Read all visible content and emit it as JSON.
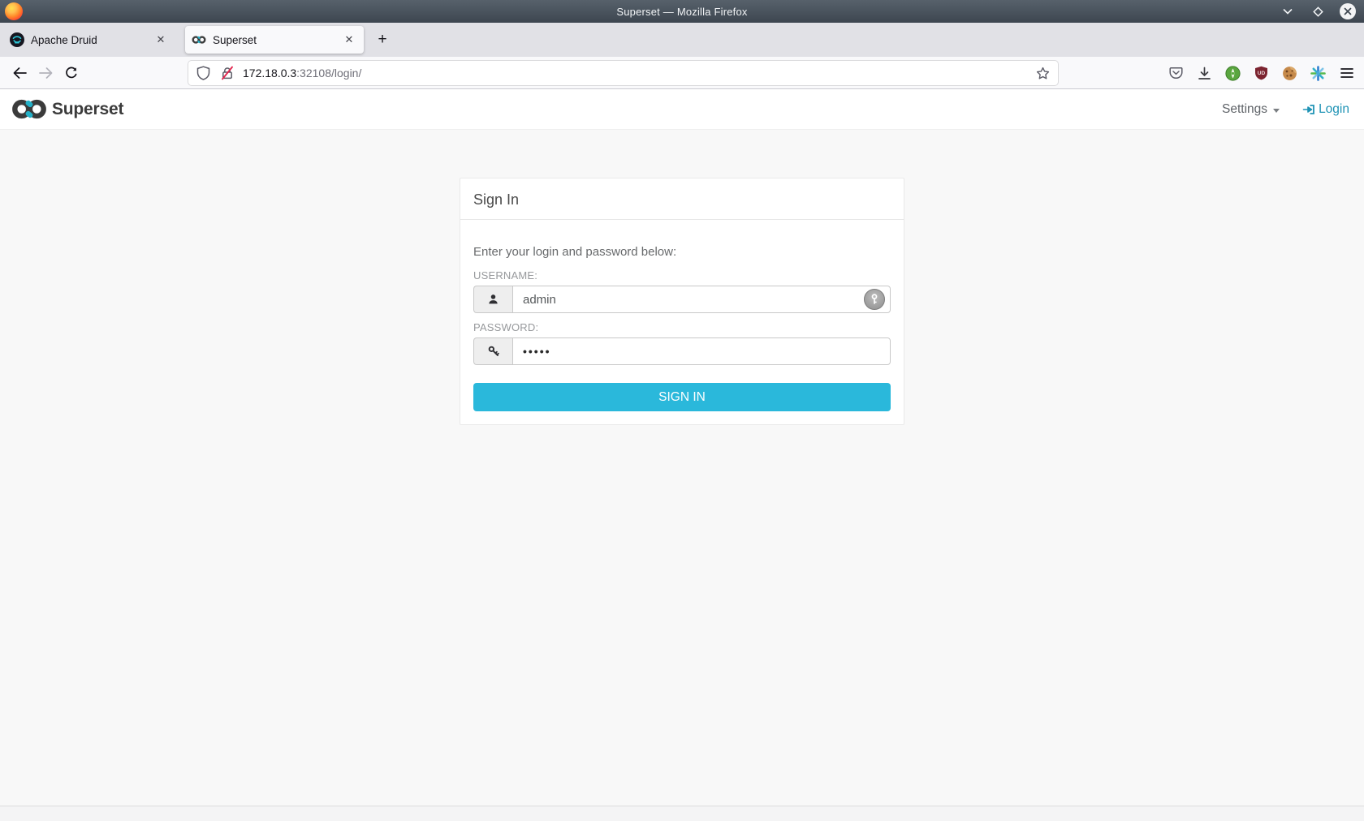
{
  "window": {
    "title": "Superset — Mozilla Firefox"
  },
  "browser": {
    "tabs": [
      {
        "label": "Apache Druid"
      },
      {
        "label": "Superset"
      }
    ],
    "new_tab": "+",
    "url": {
      "host": "172.18.0.3",
      "rest": ":32108/login/"
    },
    "extension_icons": [
      "pocket-icon",
      "download-icon",
      "green-extension-icon",
      "shield-extension-icon",
      "cookie-extension-icon",
      "starburst-extension-icon",
      "menu-icon"
    ]
  },
  "navbar": {
    "brand": "Superset",
    "settings": "Settings",
    "login": "Login"
  },
  "signin": {
    "title": "Sign In",
    "instructions": "Enter your login and password below:",
    "username_label": "USERNAME:",
    "username_value": "admin",
    "password_label": "PASSWORD:",
    "password_masked": "•••••",
    "submit": "SIGN IN"
  },
  "colors": {
    "accent_teal": "#1f93b5",
    "button_cyan": "#2ab8db",
    "titlebar": "#454f58",
    "page_bg": "#f8f8f8"
  }
}
